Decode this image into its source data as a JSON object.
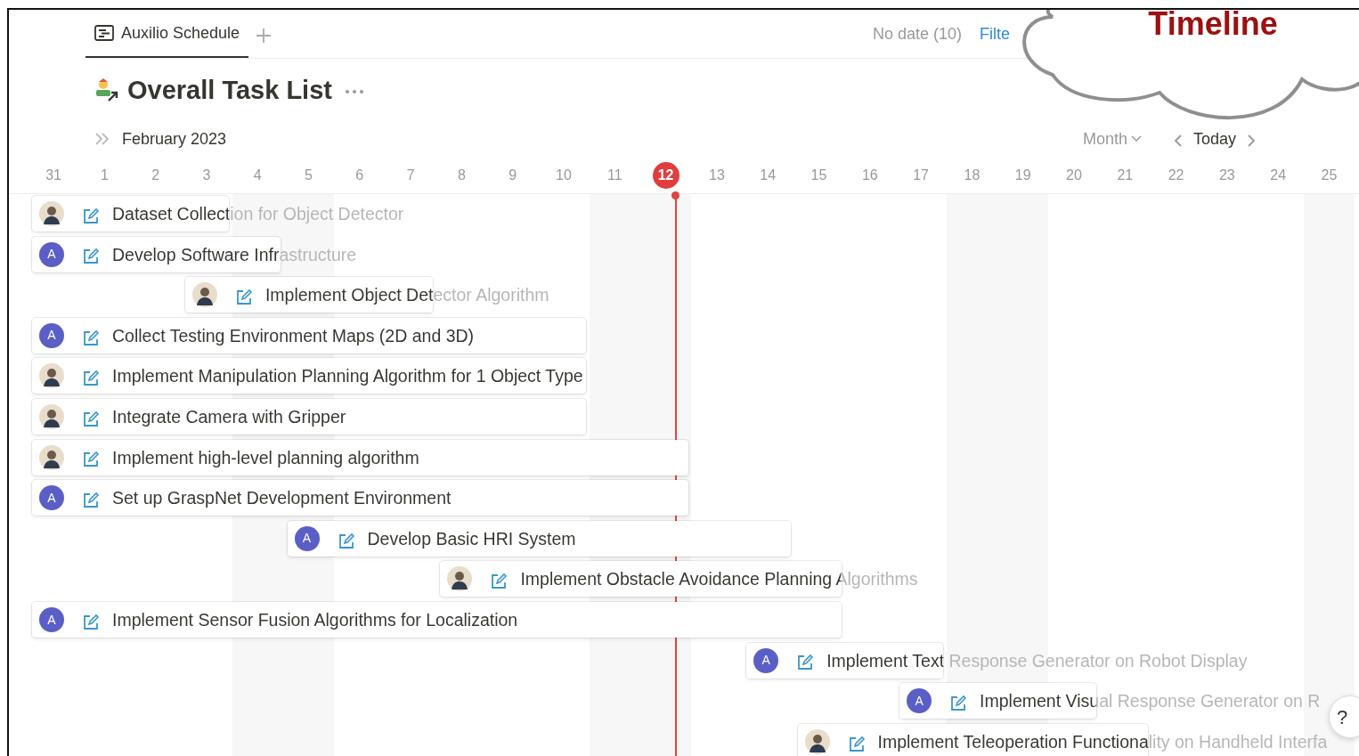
{
  "callout": {
    "text": "Timeline"
  },
  "tabs": [
    {
      "label": "Auxilio Schedule",
      "selected": true
    }
  ],
  "toolbar": {
    "no_date": "No date (10)",
    "filter": "Filte"
  },
  "page": {
    "title": "Overall Task List"
  },
  "timeline": {
    "month": "February 2023",
    "scale": "Month",
    "today_button": "Today",
    "days": [
      {
        "label": "31",
        "weekend": false,
        "today": false
      },
      {
        "label": "1",
        "weekend": false,
        "today": false
      },
      {
        "label": "2",
        "weekend": false,
        "today": false
      },
      {
        "label": "3",
        "weekend": false,
        "today": false
      },
      {
        "label": "4",
        "weekend": true,
        "today": false
      },
      {
        "label": "5",
        "weekend": true,
        "today": false
      },
      {
        "label": "6",
        "weekend": false,
        "today": false
      },
      {
        "label": "7",
        "weekend": false,
        "today": false
      },
      {
        "label": "8",
        "weekend": false,
        "today": false
      },
      {
        "label": "9",
        "weekend": false,
        "today": false
      },
      {
        "label": "10",
        "weekend": false,
        "today": false
      },
      {
        "label": "11",
        "weekend": true,
        "today": false
      },
      {
        "label": "12",
        "weekend": true,
        "today": true
      },
      {
        "label": "13",
        "weekend": false,
        "today": false
      },
      {
        "label": "14",
        "weekend": false,
        "today": false
      },
      {
        "label": "15",
        "weekend": false,
        "today": false
      },
      {
        "label": "16",
        "weekend": false,
        "today": false
      },
      {
        "label": "17",
        "weekend": false,
        "today": false
      },
      {
        "label": "18",
        "weekend": true,
        "today": false
      },
      {
        "label": "19",
        "weekend": true,
        "today": false
      },
      {
        "label": "20",
        "weekend": false,
        "today": false
      },
      {
        "label": "21",
        "weekend": false,
        "today": false
      },
      {
        "label": "22",
        "weekend": false,
        "today": false
      },
      {
        "label": "23",
        "weekend": false,
        "today": false
      },
      {
        "label": "24",
        "weekend": false,
        "today": false
      },
      {
        "label": "25",
        "weekend": true,
        "today": false
      }
    ]
  },
  "tasks": [
    {
      "title": "Dataset Collection for Object Detector",
      "avatar": {
        "kind": "photo"
      }
    },
    {
      "title": "Develop Software Infrastructure",
      "avatar": {
        "kind": "letter",
        "letter": "A"
      }
    },
    {
      "title": "Implement Object Detector Algorithm",
      "avatar": {
        "kind": "photo"
      }
    },
    {
      "title": "Collect Testing Environment Maps (2D and 3D)",
      "avatar": {
        "kind": "letter",
        "letter": "A"
      }
    },
    {
      "title": "Implement Manipulation Planning Algorithm for 1 Object Type",
      "avatar": {
        "kind": "photo"
      }
    },
    {
      "title": "Integrate Camera with Gripper",
      "avatar": {
        "kind": "photo"
      }
    },
    {
      "title": "Implement high-level planning algorithm",
      "avatar": {
        "kind": "photo"
      }
    },
    {
      "title": "Set up GraspNet Development Environment",
      "avatar": {
        "kind": "letter",
        "letter": "A"
      }
    },
    {
      "title": "Develop Basic HRI System",
      "avatar": {
        "kind": "letter",
        "letter": "A"
      }
    },
    {
      "title": "Implement Obstacle Avoidance Planning Algorithms",
      "avatar": {
        "kind": "photo"
      }
    },
    {
      "title": "Implement Sensor Fusion Algorithms for Localization",
      "avatar": {
        "kind": "letter",
        "letter": "A"
      }
    },
    {
      "title": "Implement Text Response Generator on Robot Display",
      "avatar": {
        "kind": "letter",
        "letter": "A"
      }
    },
    {
      "title": "Implement Visual Response Generator on R",
      "avatar": {
        "kind": "letter",
        "letter": "A"
      }
    },
    {
      "title": "Implement Teleoperation Functionality on Handheld Interfa",
      "avatar": {
        "kind": "photo"
      }
    }
  ],
  "help": {
    "label": "?"
  }
}
